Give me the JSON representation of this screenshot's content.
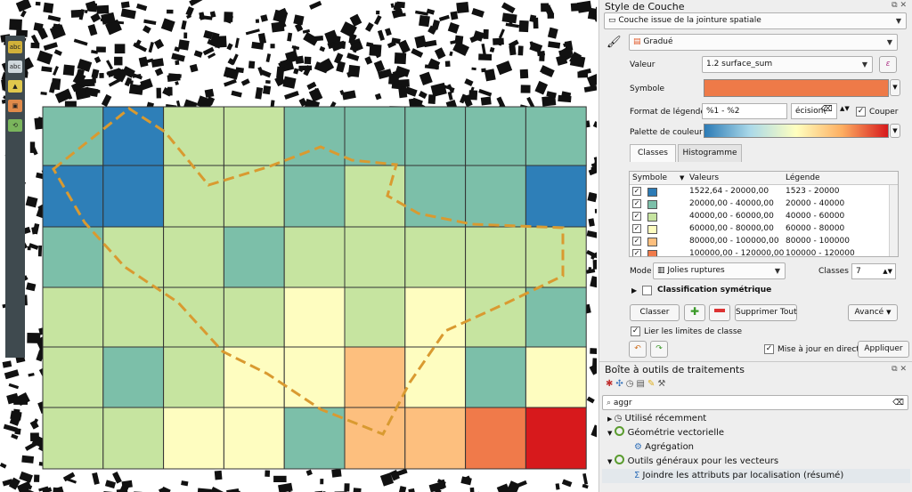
{
  "map": {
    "grid": {
      "rows": 6,
      "cols": 9,
      "cells": [
        [
          "#7cbfa9",
          "#2e7fb8",
          "#c6e4a0",
          "#c6e4a0",
          "#7cbfa9",
          "#7cbfa9",
          "#7cbfa9",
          "#7cbfa9",
          "#7cbfa9"
        ],
        [
          "#2e7fb8",
          "#2e7fb8",
          "#c6e4a0",
          "#c6e4a0",
          "#7cbfa9",
          "#c6e4a0",
          "#7cbfa9",
          "#7cbfa9",
          "#2e7fb8"
        ],
        [
          "#7cbfa9",
          "#c6e4a0",
          "#c6e4a0",
          "#7cbfa9",
          "#c6e4a0",
          "#c6e4a0",
          "#c6e4a0",
          "#c6e4a0",
          "#c6e4a0"
        ],
        [
          "#c6e4a0",
          "#c6e4a0",
          "#c6e4a0",
          "#c6e4a0",
          "#fefdc0",
          "#c6e4a0",
          "#fefdc0",
          "#c6e4a0",
          "#7cbfa9"
        ],
        [
          "#c6e4a0",
          "#7cbfa9",
          "#c6e4a0",
          "#fefdc0",
          "#fefdc0",
          "#fdbf7e",
          "#fefdc0",
          "#7cbfa9",
          "#fefdc0"
        ],
        [
          "#c6e4a0",
          "#c6e4a0",
          "#fefdc0",
          "#fefdc0",
          "#7cbfa9",
          "#fdbf7e",
          "#fdbf7e",
          "#f07a4a",
          "#d7191c"
        ]
      ]
    }
  },
  "style_panel": {
    "title": "Style de Couche",
    "layer": "Couche issue de la jointure spatiale",
    "renderer": "Gradué",
    "value_label": "Valeur",
    "value_field": "1.2 surface_sum",
    "symbol_label": "Symbole",
    "symbol_color": "#ee7a48",
    "legend_format_label": "Format de légende",
    "legend_format": "%1 - %2",
    "precision_text": "écision(",
    "cut_label": "Couper",
    "palette_label": "Palette de couleur",
    "tabs": [
      "Classes",
      "Histogramme"
    ],
    "columns": [
      "Symbole",
      "Valeurs",
      "Légende"
    ],
    "classes": [
      {
        "color": "#2c7bb6",
        "values": "1522,64 - 20000,00",
        "legend": "1523 - 20000"
      },
      {
        "color": "#7cbfa9",
        "values": "20000,00 - 40000,00",
        "legend": "20000 - 40000"
      },
      {
        "color": "#c6e4a0",
        "values": "40000,00 - 60000,00",
        "legend": "40000 - 60000"
      },
      {
        "color": "#fefdc0",
        "values": "60000,00 - 80000,00",
        "legend": "60000 - 80000"
      },
      {
        "color": "#fdbf7e",
        "values": "80000,00 - 100000,00",
        "legend": "80000 - 100000"
      },
      {
        "color": "#f07a4a",
        "values": "100000,00 - 120000,00",
        "legend": "100000 - 120000"
      }
    ],
    "mode_label": "Mode",
    "mode_value": "Jolies ruptures",
    "classes_label": "Classes",
    "classes_count": "7",
    "symmetric_label": "Classification symétrique",
    "classify_btn": "Classer",
    "delete_all_btn": "Supprimer Tout",
    "advanced_btn": "Avancé",
    "link_bounds_label": "Lier les limites de classe",
    "live_update_label": "Mise à jour en direct",
    "apply_btn": "Appliquer"
  },
  "toolbox": {
    "title": "Boîte à outils de traitements",
    "search_value": "aggr",
    "tree": [
      {
        "label": "Utilisé récemment",
        "level": 0,
        "icon": "clock-icon"
      },
      {
        "label": "Géométrie vectorielle",
        "level": 0,
        "icon": "qgis-icon"
      },
      {
        "label": "Agrégation",
        "level": 1,
        "icon": "gear-icon"
      },
      {
        "label": "Outils généraux pour les vecteurs",
        "level": 0,
        "icon": "qgis-icon"
      },
      {
        "label": "Joindre les attributs par localisation (résumé)",
        "level": 1,
        "icon": "sigma-icon"
      }
    ]
  }
}
